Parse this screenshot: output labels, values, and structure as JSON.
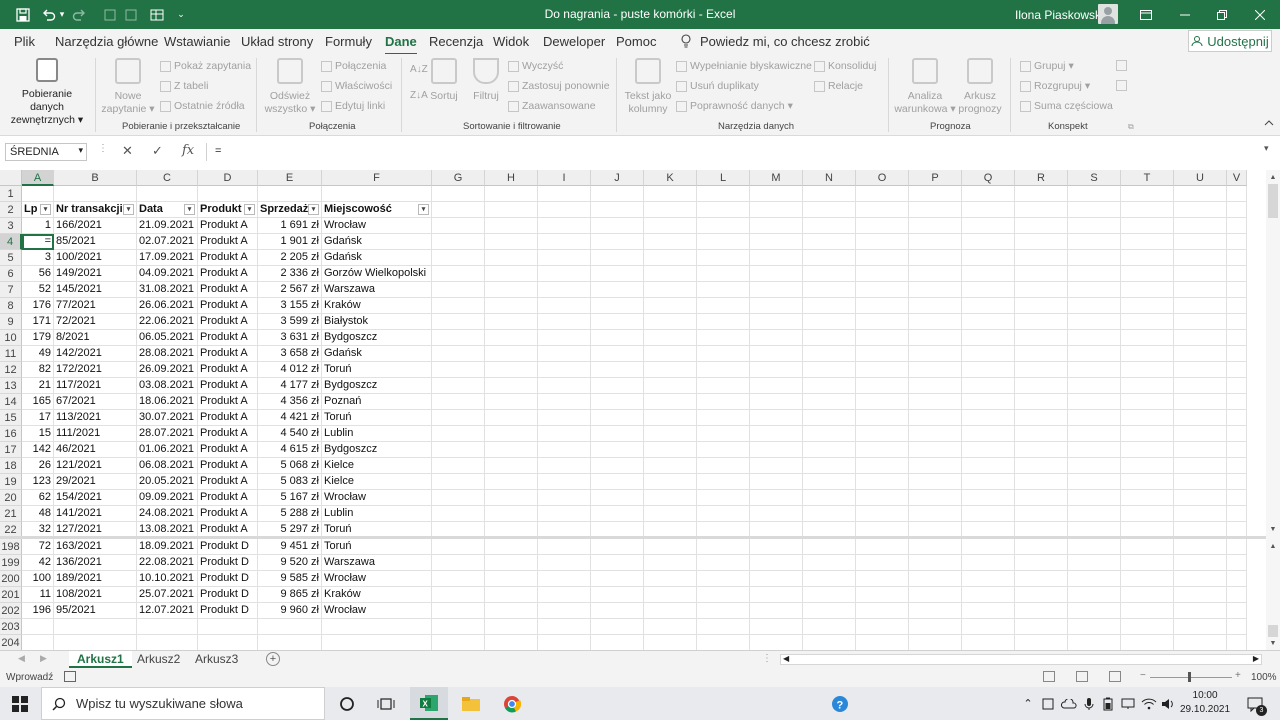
{
  "titlebar": {
    "title": "Do nagrania - puste komórki  -  Excel",
    "user": "Ilona Piaskowska",
    "qat_more": "⌄"
  },
  "tabs": [
    "Plik",
    "Narzędzia główne",
    "Wstawianie",
    "Układ strony",
    "Formuły",
    "Dane",
    "Recenzja",
    "Widok",
    "Deweloper",
    "Pomoc"
  ],
  "active_tab": "Dane",
  "tellme": "Powiedz mi, co chcesz zrobić",
  "share": "Udostępnij",
  "ribbon": {
    "get_data": [
      "Pobieranie danych",
      "zewnętrznych"
    ],
    "new_query": [
      "Nowe",
      "zapytanie"
    ],
    "show_queries": "Pokaż zapytania",
    "from_table": "Z tabeli",
    "recent_sources": "Ostatnie źródła",
    "group1": "Pobieranie i przekształcanie",
    "refresh_all": [
      "Odśwież",
      "wszystko"
    ],
    "connections": "Połączenia",
    "properties": "Właściwości",
    "edit_links": "Edytuj linki",
    "group2": "Połączenia",
    "sort": "Sortuj",
    "filter": "Filtruj",
    "clear": "Wyczyść",
    "reapply": "Zastosuj ponownie",
    "advanced": "Zaawansowane",
    "group3": "Sortowanie i filtrowanie",
    "text_to_columns": [
      "Tekst jako",
      "kolumny"
    ],
    "flash_fill": "Wypełnianie błyskawiczne",
    "remove_duplicates": "Usuń duplikaty",
    "data_validation": "Poprawność danych",
    "consolidate": "Konsoliduj",
    "relations": "Relacje",
    "group4": "Narzędzia danych",
    "whatif": [
      "Analiza",
      "warunkowa"
    ],
    "forecast_sheet": [
      "Arkusz",
      "prognozy"
    ],
    "group5": "Prognoza",
    "group_btn": "Grupuj",
    "ungroup_btn": "Rozgrupuj",
    "subtotal": "Suma częściowa",
    "group6": "Konspekt"
  },
  "formula_bar": {
    "name_box": "ŚREDNIA",
    "formula": "=",
    "fx": "fx"
  },
  "columns": [
    "A",
    "B",
    "C",
    "D",
    "E",
    "F",
    "G",
    "H",
    "I",
    "J",
    "K",
    "L",
    "M",
    "N",
    "O",
    "P",
    "Q",
    "R",
    "S",
    "T",
    "U",
    "V"
  ],
  "header_row": {
    "num": "2",
    "cells": [
      "Lp",
      "Nr transakcji",
      "Data",
      "Produkt",
      "Sprzedaż",
      "Miejscowość"
    ]
  },
  "rows": [
    {
      "num": "1",
      "cells": [
        "",
        "",
        "",
        "",
        "",
        ""
      ]
    },
    {
      "num": "3",
      "cells": [
        "1",
        "166/2021",
        "21.09.2021",
        "Produkt A",
        "1 691 zł",
        "Wrocław"
      ]
    },
    {
      "num": "4",
      "cells": [
        "=",
        "85/2021",
        "02.07.2021",
        "Produkt A",
        "1 901 zł",
        "Gdańsk"
      ]
    },
    {
      "num": "5",
      "cells": [
        "3",
        "100/2021",
        "17.09.2021",
        "Produkt A",
        "2 205 zł",
        "Gdańsk"
      ]
    },
    {
      "num": "6",
      "cells": [
        "56",
        "149/2021",
        "04.09.2021",
        "Produkt A",
        "2 336 zł",
        "Gorzów Wielkopolski"
      ]
    },
    {
      "num": "7",
      "cells": [
        "52",
        "145/2021",
        "31.08.2021",
        "Produkt A",
        "2 567 zł",
        "Warszawa"
      ]
    },
    {
      "num": "8",
      "cells": [
        "176",
        "77/2021",
        "26.06.2021",
        "Produkt A",
        "3 155 zł",
        "Kraków"
      ]
    },
    {
      "num": "9",
      "cells": [
        "171",
        "72/2021",
        "22.06.2021",
        "Produkt A",
        "3 599 zł",
        "Białystok"
      ]
    },
    {
      "num": "10",
      "cells": [
        "179",
        "8/2021",
        "06.05.2021",
        "Produkt A",
        "3 631 zł",
        "Bydgoszcz"
      ]
    },
    {
      "num": "11",
      "cells": [
        "49",
        "142/2021",
        "28.08.2021",
        "Produkt A",
        "3 658 zł",
        "Gdańsk"
      ]
    },
    {
      "num": "12",
      "cells": [
        "82",
        "172/2021",
        "26.09.2021",
        "Produkt A",
        "4 012 zł",
        "Toruń"
      ]
    },
    {
      "num": "13",
      "cells": [
        "21",
        "117/2021",
        "03.08.2021",
        "Produkt A",
        "4 177 zł",
        "Bydgoszcz"
      ]
    },
    {
      "num": "14",
      "cells": [
        "165",
        "67/2021",
        "18.06.2021",
        "Produkt A",
        "4 356 zł",
        "Poznań"
      ]
    },
    {
      "num": "15",
      "cells": [
        "17",
        "113/2021",
        "30.07.2021",
        "Produkt A",
        "4 421 zł",
        "Toruń"
      ]
    },
    {
      "num": "16",
      "cells": [
        "15",
        "111/2021",
        "28.07.2021",
        "Produkt A",
        "4 540 zł",
        "Lublin"
      ]
    },
    {
      "num": "17",
      "cells": [
        "142",
        "46/2021",
        "01.06.2021",
        "Produkt A",
        "4 615 zł",
        "Bydgoszcz"
      ]
    },
    {
      "num": "18",
      "cells": [
        "26",
        "121/2021",
        "06.08.2021",
        "Produkt A",
        "5 068 zł",
        "Kielce"
      ]
    },
    {
      "num": "19",
      "cells": [
        "123",
        "29/2021",
        "20.05.2021",
        "Produkt A",
        "5 083 zł",
        "Kielce"
      ]
    },
    {
      "num": "20",
      "cells": [
        "62",
        "154/2021",
        "09.09.2021",
        "Produkt A",
        "5 167 zł",
        "Wrocław"
      ]
    },
    {
      "num": "21",
      "cells": [
        "48",
        "141/2021",
        "24.08.2021",
        "Produkt A",
        "5 288 zł",
        "Lublin"
      ]
    },
    {
      "num": "22",
      "cells": [
        "32",
        "127/2021",
        "13.08.2021",
        "Produkt A",
        "5 297 zł",
        "Toruń"
      ]
    }
  ],
  "rows_bottom": [
    {
      "num": "198",
      "cells": [
        "72",
        "163/2021",
        "18.09.2021",
        "Produkt D",
        "9 451 zł",
        "Toruń"
      ]
    },
    {
      "num": "199",
      "cells": [
        "42",
        "136/2021",
        "22.08.2021",
        "Produkt D",
        "9 520 zł",
        "Warszawa"
      ]
    },
    {
      "num": "200",
      "cells": [
        "100",
        "189/2021",
        "10.10.2021",
        "Produkt D",
        "9 585 zł",
        "Wrocław"
      ]
    },
    {
      "num": "201",
      "cells": [
        "11",
        "108/2021",
        "25.07.2021",
        "Produkt D",
        "9 865 zł",
        "Kraków"
      ]
    },
    {
      "num": "202",
      "cells": [
        "196",
        "95/2021",
        "12.07.2021",
        "Produkt D",
        "9 960 zł",
        "Wrocław"
      ]
    },
    {
      "num": "203",
      "cells": [
        "",
        "",
        "",
        "",
        "",
        ""
      ]
    },
    {
      "num": "204",
      "cells": [
        "",
        "",
        "",
        "",
        "",
        ""
      ]
    }
  ],
  "sheets": [
    "Arkusz1",
    "Arkusz2",
    "Arkusz3"
  ],
  "active_sheet": "Arkusz1",
  "status": {
    "mode": "Wprowadź",
    "zoom": "100%"
  },
  "taskbar": {
    "search_placeholder": "Wpisz tu wyszukiwane słowa",
    "time": "10:00",
    "date": "29.10.2021",
    "notif_count": "3"
  },
  "colors": {
    "accent": "#217346"
  }
}
